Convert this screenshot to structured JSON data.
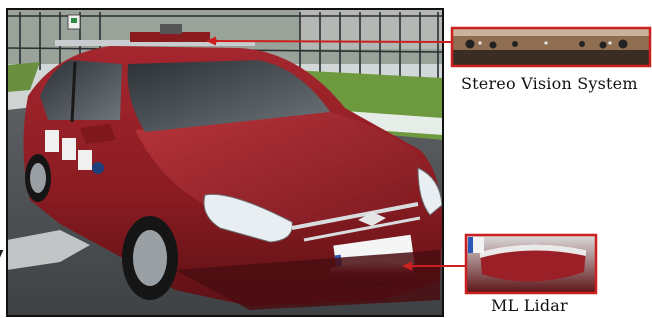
{
  "figure": {
    "callouts": [
      {
        "id": "stereo",
        "label": "Stereo Vision System",
        "icon": "stereo-camera-inset"
      },
      {
        "id": "lidar",
        "label": "ML Lidar",
        "icon": "lidar-sensor-inset"
      }
    ],
    "colors": {
      "car_body": "#8b1c22",
      "callout_line": "#cc1f1f",
      "inset_border": "#cc1f1f",
      "photo_border": "#111111"
    }
  }
}
